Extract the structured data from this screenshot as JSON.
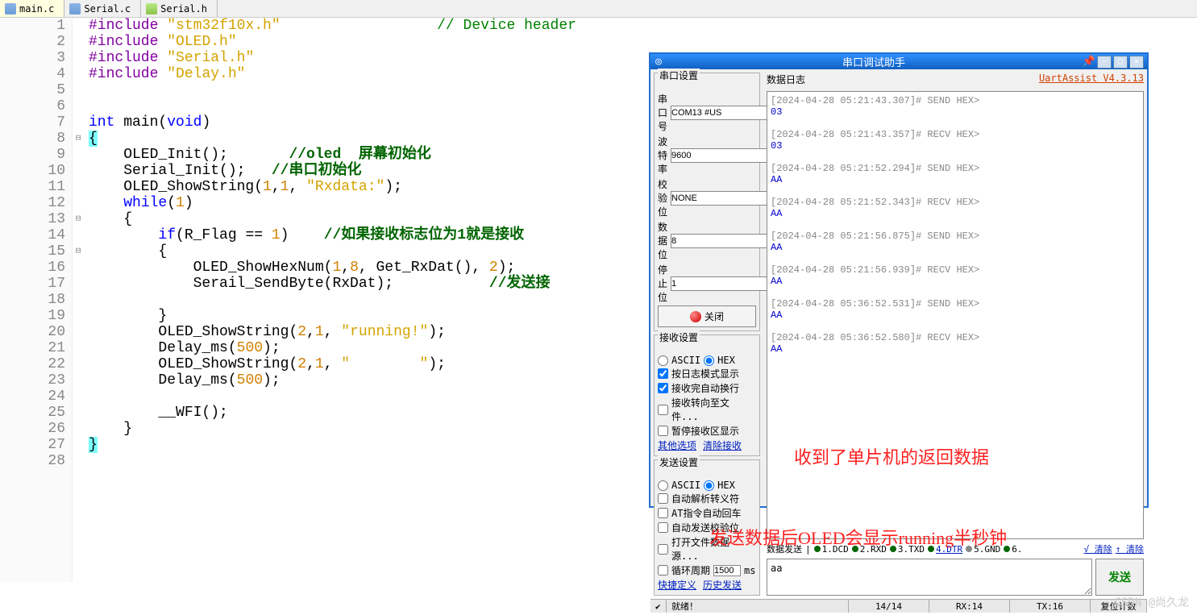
{
  "tabs": [
    {
      "label": "main.c",
      "icon": "c",
      "active": true
    },
    {
      "label": "Serial.c",
      "icon": "c",
      "active": false
    },
    {
      "label": "Serial.h",
      "icon": "h",
      "active": false
    }
  ],
  "code": {
    "lines": [
      {
        "n": 1,
        "html": "<span class='pre'>#include</span> <span class='str'>\"stm32f10x.h\"</span>                  <span class='cmt'>// Device header</span>"
      },
      {
        "n": 2,
        "html": "<span class='pre'>#include</span> <span class='str'>\"OLED.h\"</span>"
      },
      {
        "n": 3,
        "html": "<span class='pre'>#include</span> <span class='str'>\"Serial.h\"</span>"
      },
      {
        "n": 4,
        "html": "<span class='pre'>#include</span> <span class='str'>\"Delay.h\"</span>"
      },
      {
        "n": 5,
        "html": ""
      },
      {
        "n": 6,
        "html": ""
      },
      {
        "n": 7,
        "html": "<span class='kw'>int</span> main(<span class='kw'>void</span>)"
      },
      {
        "n": 8,
        "fold": "⊟",
        "html": "<span class='hl'>{</span>"
      },
      {
        "n": 9,
        "html": "    OLED_Init();       <span class='cmt2'>//oled  屏幕初始化</span>"
      },
      {
        "n": 10,
        "html": "    Serial_Init();   <span class='cmt2'>//串口初始化</span>"
      },
      {
        "n": 11,
        "html": "    OLED_ShowString(<span class='num'>1</span>,<span class='num'>1</span>, <span class='str'>\"Rxdata:\"</span>);"
      },
      {
        "n": 12,
        "html": "    <span class='kw'>while</span>(<span class='num'>1</span>)"
      },
      {
        "n": 13,
        "fold": "⊟",
        "html": "    {"
      },
      {
        "n": 14,
        "html": "        <span class='kw'>if</span>(R_Flag == <span class='num'>1</span>)    <span class='cmt2'>//如果接收标志位为1就是接收</span>"
      },
      {
        "n": 15,
        "fold": "⊟",
        "html": "        {"
      },
      {
        "n": 16,
        "html": "            OLED_ShowHexNum(<span class='num'>1</span>,<span class='num'>8</span>, Get_RxDat(), <span class='num'>2</span>);"
      },
      {
        "n": 17,
        "html": "            Serail_SendByte(RxDat);           <span class='cmt2'>//发送接</span>"
      },
      {
        "n": 18,
        "html": ""
      },
      {
        "n": 19,
        "html": "        }"
      },
      {
        "n": 20,
        "html": "        OLED_ShowString(<span class='num'>2</span>,<span class='num'>1</span>, <span class='str'>\"running!\"</span>);"
      },
      {
        "n": 21,
        "html": "        Delay_ms(<span class='num'>500</span>);"
      },
      {
        "n": 22,
        "html": "        OLED_ShowString(<span class='num'>2</span>,<span class='num'>1</span>, <span class='str'>\"        \"</span>);"
      },
      {
        "n": 23,
        "html": "        Delay_ms(<span class='num'>500</span>);"
      },
      {
        "n": 24,
        "html": ""
      },
      {
        "n": 25,
        "html": "        __WFI();"
      },
      {
        "n": 26,
        "html": "    }"
      },
      {
        "n": 27,
        "html": "<span class='hl'>}</span>"
      },
      {
        "n": 28,
        "html": ""
      }
    ]
  },
  "uart": {
    "title": "串口调试助手",
    "version_label": "UartAssist V4.3.13",
    "port_settings": {
      "title": "串口设置",
      "port_label": "串口号",
      "port_value": "COM13 #US",
      "baud_label": "波特率",
      "baud_value": "9600",
      "parity_label": "校验位",
      "parity_value": "NONE",
      "data_label": "数据位",
      "data_value": "8",
      "stop_label": "停止位",
      "stop_value": "1",
      "close_btn": "关闭"
    },
    "recv_settings": {
      "title": "接收设置",
      "ascii": "ASCII",
      "hex": "HEX",
      "opt1": "按日志模式显示",
      "opt2": "接收完自动换行",
      "opt3": "接收转向至文件...",
      "opt4": "暂停接收区显示",
      "link1": "其他选项",
      "link2": "清除接收"
    },
    "send_settings": {
      "title": "发送设置",
      "ascii": "ASCII",
      "hex": "HEX",
      "opt1": "自动解析转义符",
      "opt2": "AT指令自动回车",
      "opt3": "自动发送校验位",
      "opt4": "打开文件数据源...",
      "cycle_label": "循环周期",
      "cycle_value": "1500",
      "cycle_unit": "ms",
      "link1": "快捷定义",
      "link2": "历史发送"
    },
    "log_title": "数据日志",
    "log": [
      {
        "ts": "[2024-04-28 05:21:43.307]# SEND HEX>",
        "hex": "03"
      },
      {
        "ts": "[2024-04-28 05:21:43.357]# RECV HEX>",
        "hex": "03"
      },
      {
        "ts": "[2024-04-28 05:21:52.294]# SEND HEX>",
        "hex": "AA"
      },
      {
        "ts": "[2024-04-28 05:21:52.343]# RECV HEX>",
        "hex": "AA"
      },
      {
        "ts": "[2024-04-28 05:21:56.875]# SEND HEX>",
        "hex": "AA"
      },
      {
        "ts": "[2024-04-28 05:21:56.939]# RECV HEX>",
        "hex": "AA"
      },
      {
        "ts": "[2024-04-28 05:36:52.531]# SEND HEX>",
        "hex": "AA"
      },
      {
        "ts": "[2024-04-28 05:36:52.580]# RECV HEX>",
        "hex": "AA"
      }
    ],
    "send_bar": {
      "label": "数据发送",
      "dcd": "1.DCD",
      "rxd": "2.RXD",
      "txd": "3.TXD",
      "dtr": "4.DTR",
      "gnd": "5.GND",
      "six": "6.",
      "clear1": "√ 清除",
      "clear2": "↑ 清除"
    },
    "send_input": "aa",
    "send_btn": "发送",
    "status": {
      "ready": "就绪！",
      "count": "14/14",
      "rx": "RX:14",
      "tx": "TX:16",
      "reset": "复位计数"
    }
  },
  "annotations": {
    "a1": "收到了单片机的返回数据",
    "a2": "发送数据后OLED会显示running半秒钟"
  },
  "watermark": "CSDN @尚久龙"
}
